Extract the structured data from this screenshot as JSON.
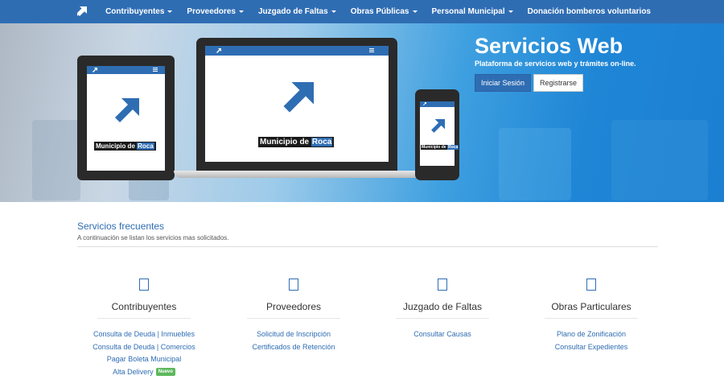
{
  "nav": {
    "items": [
      {
        "label": "Contribuyentes",
        "has_caret": true
      },
      {
        "label": "Proveedores",
        "has_caret": true
      },
      {
        "label": "Juzgado de Faltas",
        "has_caret": true
      },
      {
        "label": "Obras Públicas",
        "has_caret": true
      },
      {
        "label": "Personal Municipal",
        "has_caret": true
      },
      {
        "label": "Donación bomberos voluntarios",
        "has_caret": false
      }
    ]
  },
  "hero": {
    "title": "Servicios Web",
    "subtitle": "Plataforma de servicios web y trámites on-line.",
    "login_label": "Iniciar Sesión",
    "register_label": "Registrarse",
    "logo_text_main": "Municipio de ",
    "logo_text_accent": "Roca"
  },
  "section": {
    "title": "Servicios frecuentes",
    "subtitle": "A continuación se listan los servicios mas solicitados."
  },
  "columns": [
    {
      "title": "Contribuyentes",
      "links": [
        "Consulta de Deuda | Inmuebles",
        "Consulta de Deuda | Comercios",
        "Pagar Boleta Municipal",
        "Alta Delivery"
      ]
    },
    {
      "title": "Proveedores",
      "links": [
        "Solicitud de Inscripción",
        "Certificados de Retención"
      ]
    },
    {
      "title": "Juzgado de Faltas",
      "links": [
        "Consultar Causas"
      ]
    },
    {
      "title": "Obras Particulares",
      "links": [
        "Plano de Zonificación",
        "Consultar Expedientes"
      ]
    }
  ],
  "badge": {
    "label": "Nuevo"
  },
  "colors": {
    "brand_blue": "#2f6db3",
    "badge_green": "#5cb85c"
  }
}
